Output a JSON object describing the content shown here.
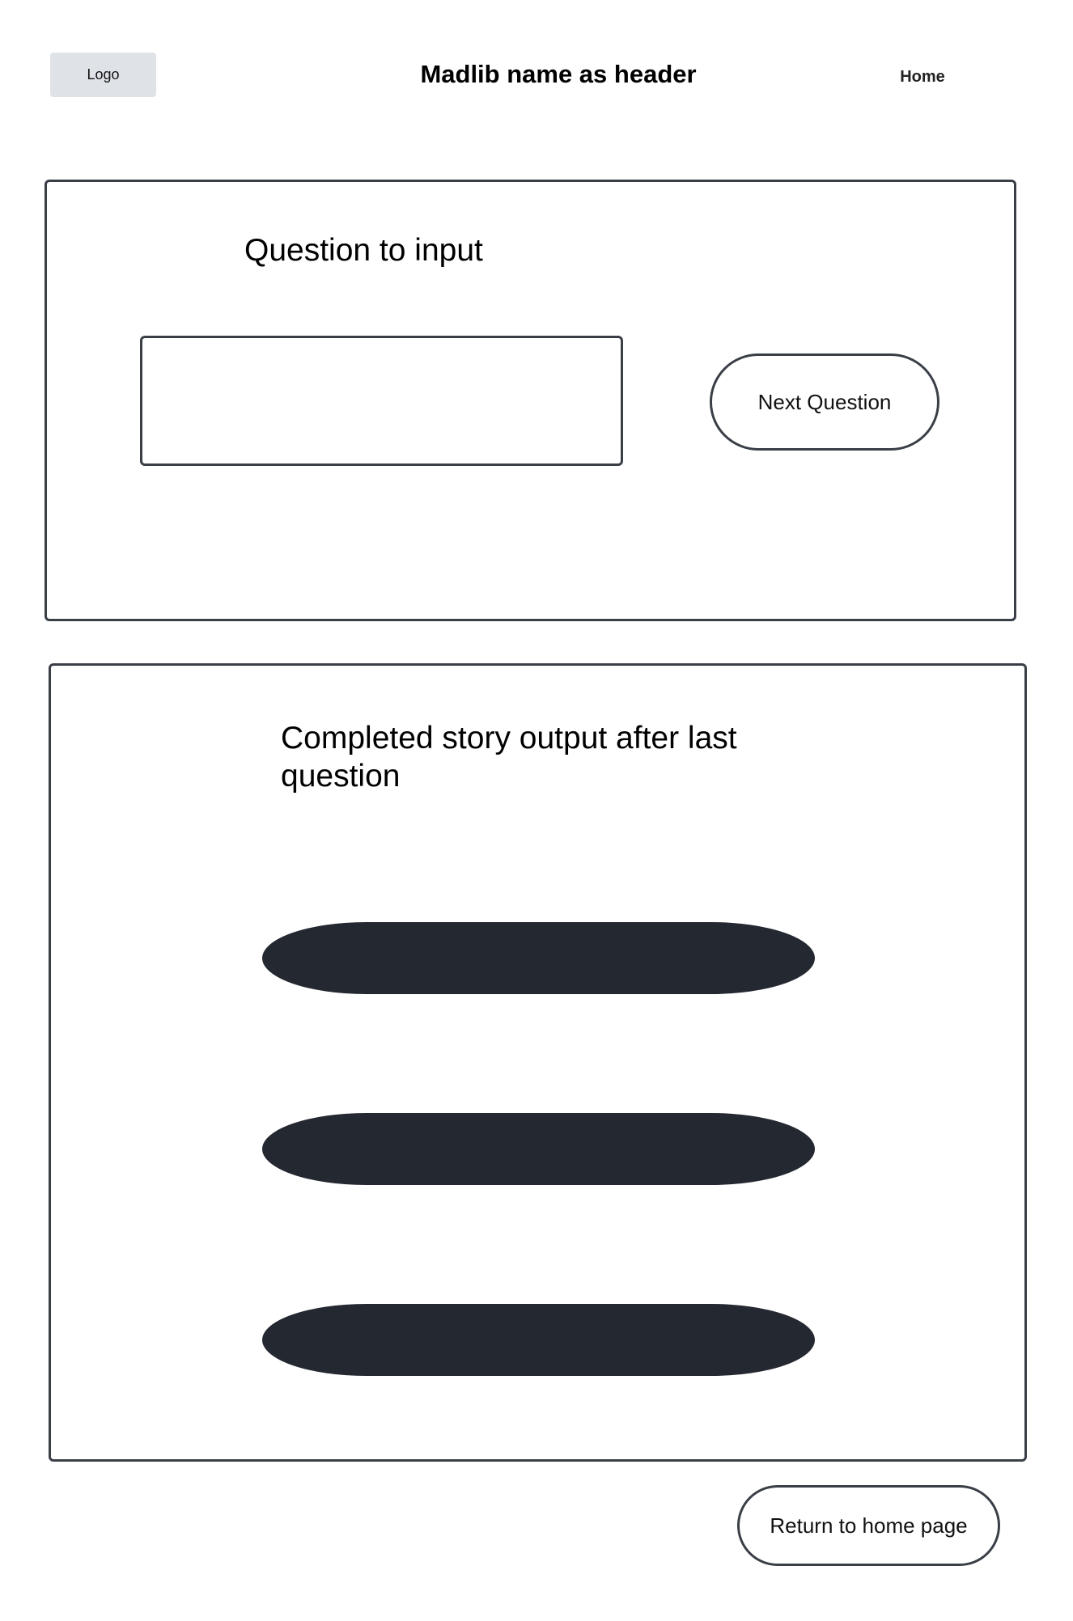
{
  "header": {
    "logo_label": "Logo",
    "title": "Madlib name as header",
    "nav_home": "Home"
  },
  "question_panel": {
    "question_label": "Question to input",
    "answer_value": "",
    "next_button_label": "Next Question"
  },
  "story_panel": {
    "story_label": "Completed story output after last question",
    "story_lines": [
      "",
      "",
      ""
    ]
  },
  "footer": {
    "return_button_label": "Return to home page"
  },
  "colors": {
    "border": "#3a3f47",
    "logo_bg": "#dfe3e7",
    "story_line_fill": "#242831"
  }
}
